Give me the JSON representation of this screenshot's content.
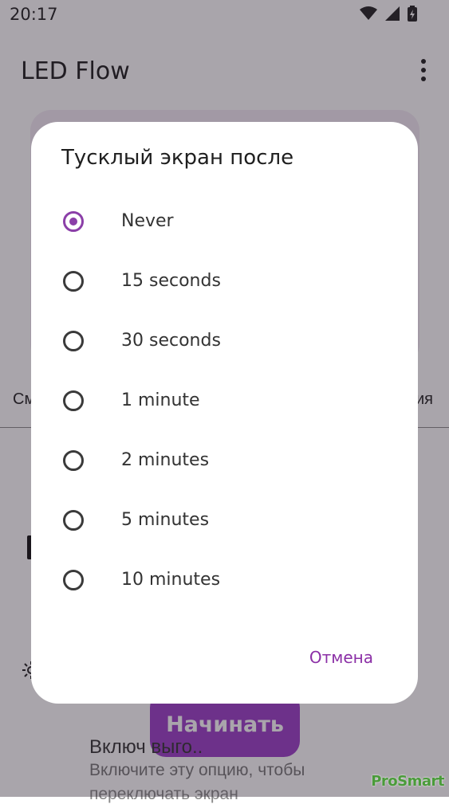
{
  "status_bar": {
    "time": "20:17",
    "icons": [
      "wifi-icon",
      "cell-signal-icon",
      "battery-charging-icon"
    ]
  },
  "app_bar": {
    "title": "LED Flow",
    "menu_icon": "more-vert-icon"
  },
  "background": {
    "tab_left_label": "См",
    "tab_right_label": "ия",
    "start_button_label": "Начинать",
    "option_title": "Включ                  выго..",
    "option_description": "Включите эту опцию, чтобы",
    "option_description_2": "переключать экран"
  },
  "dialog": {
    "title": "Тусклый экран после",
    "selected_option": "Never",
    "options": [
      {
        "label": "Never",
        "checked": true
      },
      {
        "label": "15 seconds",
        "checked": false
      },
      {
        "label": "30 seconds",
        "checked": false
      },
      {
        "label": "1 minute",
        "checked": false
      },
      {
        "label": "2 minutes",
        "checked": false
      },
      {
        "label": "5 minutes",
        "checked": false
      },
      {
        "label": "10 minutes",
        "checked": false
      }
    ],
    "cancel_label": "Отмена"
  },
  "watermark": "ProSmart",
  "colors": {
    "accent": "#8b3fa8",
    "start_button": "#9b3fc8",
    "cancel_text": "#8b2fa6",
    "scrim": "rgba(40,30,45,0.40)"
  }
}
